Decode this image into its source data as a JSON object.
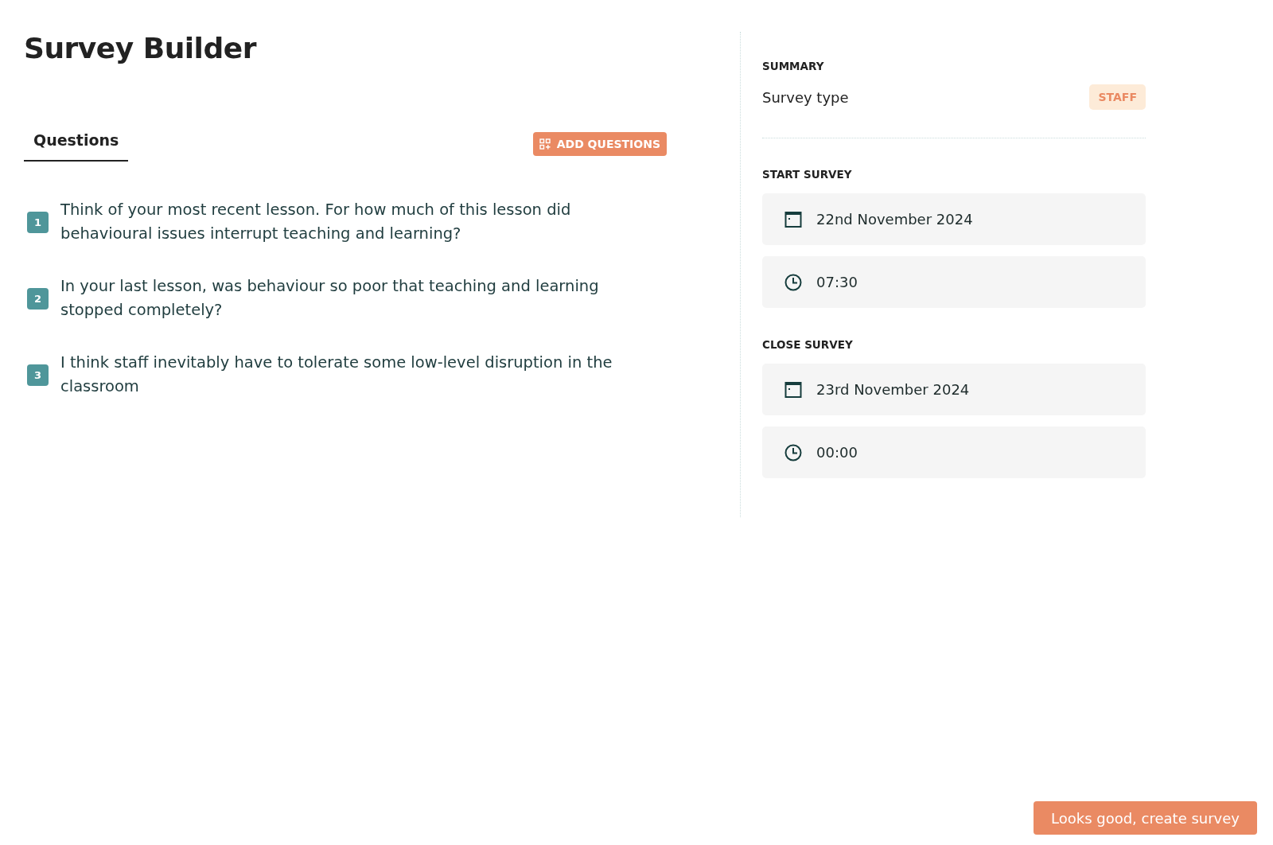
{
  "title": "Survey Builder",
  "tabs": [
    {
      "label": "Questions",
      "selected": true
    }
  ],
  "add_button": "ADD QUESTIONS",
  "questions": [
    {
      "number": "1",
      "text": "Think of your most recent lesson. For how much of this lesson did behavioural issues interrupt teaching and learning?"
    },
    {
      "number": "2",
      "text": "In your last lesson, was behaviour so poor that teaching and learning stopped completely?"
    },
    {
      "number": "3",
      "text": "I think staff inevitably have to tolerate some low-level disruption in the classroom"
    }
  ],
  "summary": {
    "heading": "SUMMARY",
    "label": "Survey type",
    "value": "STAFF"
  },
  "sections": [
    {
      "heading": "START SURVEY",
      "fields": [
        {
          "kind": "date",
          "value": "22nd November 2024"
        },
        {
          "kind": "time",
          "value": "07:30"
        }
      ]
    },
    {
      "heading": "CLOSE SURVEY",
      "fields": [
        {
          "kind": "date",
          "value": "23rd November 2024"
        },
        {
          "kind": "time",
          "value": "00:00"
        }
      ]
    }
  ],
  "create_button": "Looks good, create survey"
}
